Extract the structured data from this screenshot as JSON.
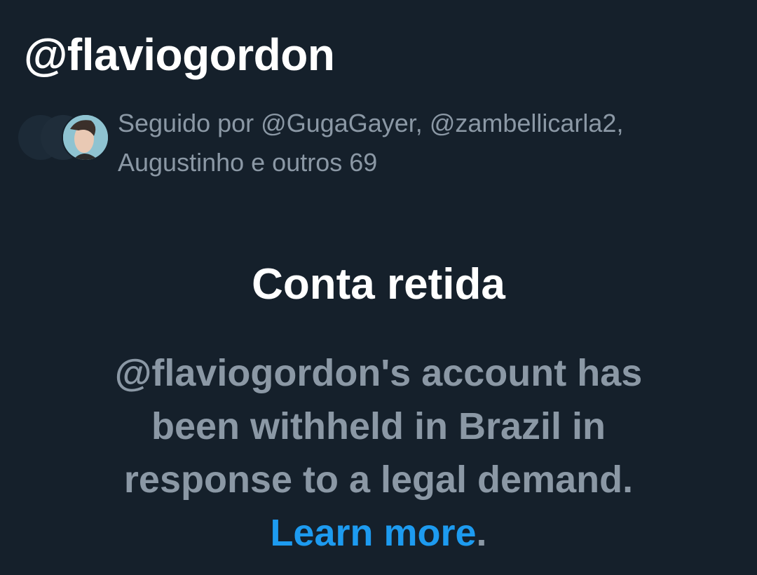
{
  "profile": {
    "handle": "@flaviogordon"
  },
  "followers": {
    "text_line1": "Seguido por @GugaGayer, @zambellicarla2,",
    "text_line2": "Augustinho e outros 69"
  },
  "withheld": {
    "title": "Conta retida",
    "message": "@flaviogordon's account has been withheld in Brazil in response to a legal demand.",
    "link_label": "Learn more",
    "trailing": "."
  },
  "colors": {
    "background": "#15202b",
    "primary_text": "#ffffff",
    "secondary_text": "#8b98a5",
    "link": "#1d9bf0"
  }
}
